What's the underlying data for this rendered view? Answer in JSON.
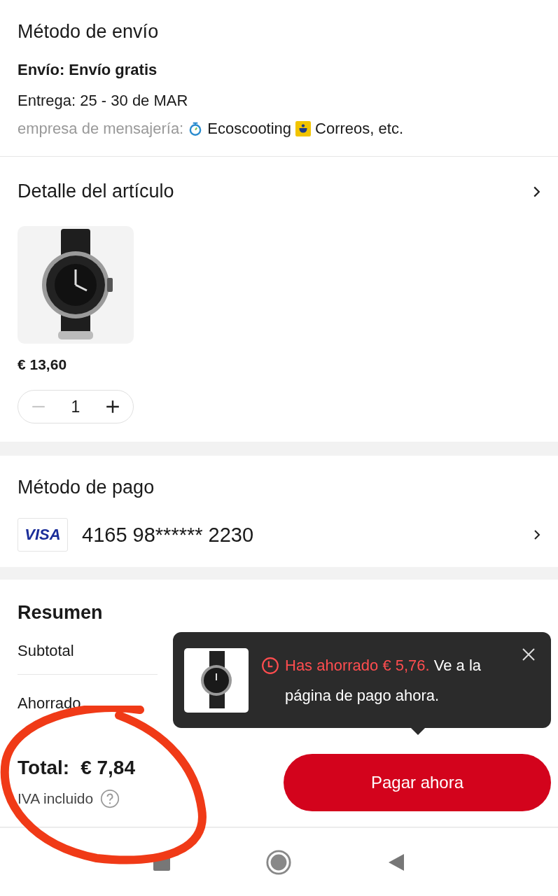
{
  "shipping": {
    "title": "Método de envío",
    "method": "Envío: Envío gratis",
    "delivery": "Entrega: 25 - 30 de MAR",
    "carrier_label": "empresa de mensajería:",
    "carriers": [
      "Ecoscooting",
      "Correos, etc."
    ]
  },
  "item_detail": {
    "title": "Detalle del artículo",
    "price": "€ 13,60",
    "quantity": "1",
    "minus_disabled": true
  },
  "payment": {
    "title": "Método de pago",
    "card_brand": "VISA",
    "card_number": "4165 98****** 2230"
  },
  "summary": {
    "title": "Resumen",
    "rows": [
      {
        "label": "Subtotal"
      },
      {
        "label": "Ahorrado"
      }
    ]
  },
  "toast": {
    "highlight": "Has ahorrado € 5,76.",
    "message": " Ve a la página de pago ahora."
  },
  "footer": {
    "total_label": "Total:",
    "total_value": "€ 7,84",
    "tax_note": "IVA incluido",
    "pay_button": "Pagar ahora"
  }
}
